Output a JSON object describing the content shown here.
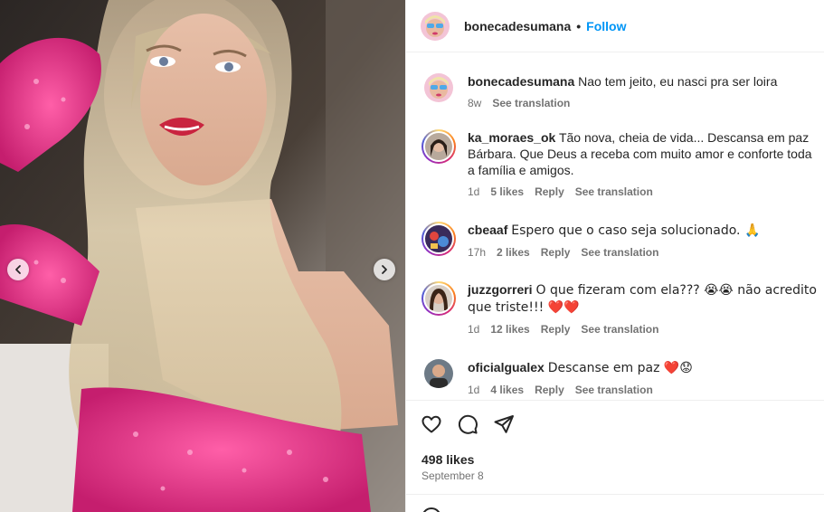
{
  "post": {
    "username": "bonecadesumana",
    "separator": "•",
    "follow_label": "Follow"
  },
  "carousel": {
    "prev_icon": "chevron-left-icon",
    "next_icon": "chevron-right-icon"
  },
  "caption": {
    "username": "bonecadesumana",
    "text": "Nao tem jeito, eu nasci pra ser loira",
    "time": "8w",
    "see_translation": "See translation"
  },
  "comments": [
    {
      "username": "ka_moraes_ok",
      "text": "Tão nova, cheia de vida... Descansa em paz Bárbara. Que Deus a receba com muito amor e conforte toda a família e amigos.",
      "time": "1d",
      "likes": "5 likes",
      "reply": "Reply",
      "see_translation": "See translation"
    },
    {
      "username": "cbeaaf",
      "text": "Espero que o caso seja solucionado. 🙏",
      "time": "17h",
      "likes": "2 likes",
      "reply": "Reply",
      "see_translation": "See translation"
    },
    {
      "username": "juzzgorreri",
      "text": "O que fizeram com ela??? 😭😭 não acredito que triste!!! ❤️❤️",
      "time": "1d",
      "likes": "12 likes",
      "reply": "Reply",
      "see_translation": "See translation"
    },
    {
      "username": "oficialgualex",
      "text": "Descanse em paz ❤️😟",
      "time": "1d",
      "likes": "4 likes",
      "reply": "Reply",
      "see_translation": "See translation"
    }
  ],
  "actions": {
    "like_icon": "heart-icon",
    "comment_icon": "comment-icon",
    "share_icon": "send-icon",
    "likes_count": "498 likes",
    "date": "September 8"
  },
  "colors": {
    "link_blue": "#0095f6",
    "secondary_text": "#737373",
    "border": "#efefef"
  }
}
